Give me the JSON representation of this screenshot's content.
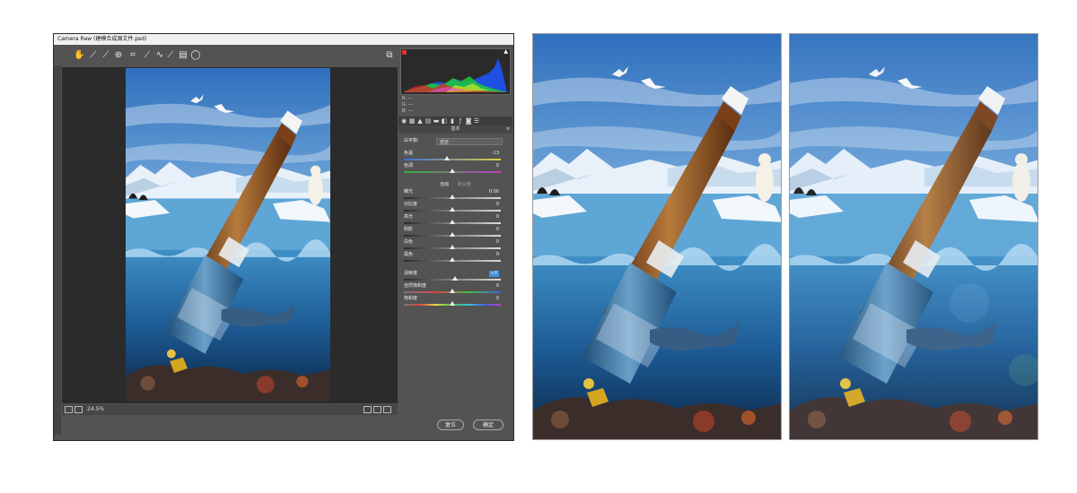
{
  "window": {
    "title": "Camera Raw (建模合成源文件.psd)"
  },
  "toolbar": {
    "tools": [
      {
        "name": "hand-tool-icon",
        "glyph": "✋"
      },
      {
        "name": "white-balance-tool-icon",
        "glyph": "⟋"
      },
      {
        "name": "color-sampler-icon",
        "glyph": "⟋"
      },
      {
        "name": "targeted-adjustment-icon",
        "glyph": "⊕"
      },
      {
        "name": "crop-tool-icon",
        "glyph": "⌗"
      },
      {
        "name": "straighten-tool-icon",
        "glyph": "⟋"
      },
      {
        "name": "spot-removal-icon",
        "glyph": "∿"
      },
      {
        "name": "red-eye-icon",
        "glyph": "⟋"
      },
      {
        "name": "adjustment-brush-icon",
        "glyph": "▤"
      },
      {
        "name": "radial-filter-icon",
        "glyph": "◯"
      }
    ],
    "fullscreen_glyph": "⧉"
  },
  "status": {
    "zoom": "24.5%"
  },
  "histogram": {
    "rgb_lines": [
      "R: ---",
      "G: ---",
      "B: ---"
    ]
  },
  "panel": {
    "title": "基本",
    "white_balance": {
      "label": "白平衡:",
      "value": "自定"
    },
    "sliders": [
      {
        "name": "temperature",
        "label": "色温",
        "value": "-13",
        "pos": 0.44,
        "track": "temp"
      },
      {
        "name": "tint",
        "label": "色调",
        "value": "0",
        "pos": 0.5,
        "track": "tint"
      },
      {
        "name": "exposure",
        "label": "曝光",
        "value": "0.00",
        "pos": 0.5,
        "track": "gray"
      },
      {
        "name": "contrast",
        "label": "对比度",
        "value": "0",
        "pos": 0.5,
        "track": "gray"
      },
      {
        "name": "highlights",
        "label": "高光",
        "value": "0",
        "pos": 0.5,
        "track": "gray"
      },
      {
        "name": "shadows",
        "label": "阴影",
        "value": "0",
        "pos": 0.5,
        "track": "gray"
      },
      {
        "name": "whites",
        "label": "白色",
        "value": "0",
        "pos": 0.5,
        "track": "gray"
      },
      {
        "name": "blacks",
        "label": "黑色",
        "value": "0",
        "pos": 0.5,
        "track": "gray"
      },
      {
        "name": "clarity",
        "label": "清晰度",
        "value": "+8",
        "pos": 0.53,
        "track": "gray",
        "highlight": true
      },
      {
        "name": "vibrance",
        "label": "自然饱和度",
        "value": "0",
        "pos": 0.5,
        "track": "vib"
      },
      {
        "name": "saturation",
        "label": "饱和度",
        "value": "0",
        "pos": 0.5,
        "track": "sat"
      }
    ],
    "auto_label": "自动",
    "default_label": "默认值"
  },
  "buttons": {
    "reset": "复位",
    "ok": "确定"
  },
  "colors": {
    "panel_bg": "#535353",
    "sky_top": "#3a76c0",
    "sky_mid": "#8fbde3",
    "ice": "#e9f1f8",
    "water_surface": "#4a93c8",
    "deep": "#10355e",
    "bottle_glass": "#6b3a1c",
    "label_blue": "#2d5a8f",
    "highlight_value": "#3b8fe0"
  }
}
